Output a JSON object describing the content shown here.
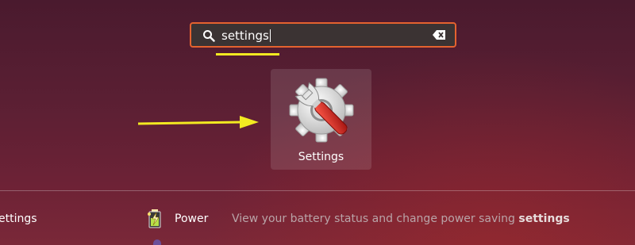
{
  "search": {
    "query": "settings",
    "icon": "search-icon",
    "clear_icon": "clear-icon",
    "accent_color": "#e4622f"
  },
  "annotations": {
    "highlight_color": "#f2ea21"
  },
  "app_result": {
    "label": "Settings",
    "icon": "settings-gear-wrench-icon"
  },
  "results_list": {
    "left_label": "ettings",
    "power": {
      "name": "Power",
      "description_prefix": "View your battery status and change power saving ",
      "description_match": "settings",
      "icon": "power-battery-icon"
    }
  }
}
